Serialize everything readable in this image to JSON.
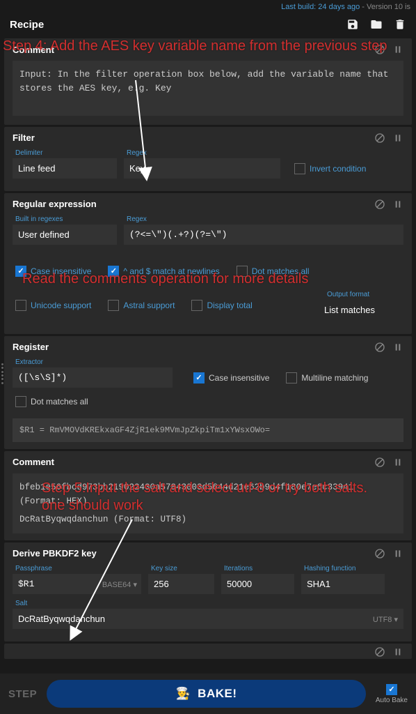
{
  "header": {
    "last_build": "Last build: 24 days ago",
    "version": " - Version 10 is"
  },
  "recipe": {
    "title": "Recipe"
  },
  "comment1": {
    "title": "Comment",
    "text": "Input: In the filter operation box below, add the variable name that stores the AES key, e.g. Key"
  },
  "filter": {
    "title": "Filter",
    "delimiter": {
      "label": "Delimiter",
      "value": "Line feed"
    },
    "regex": {
      "label": "Regex",
      "value": "Key"
    },
    "invert": "Invert condition"
  },
  "regex_op": {
    "title": "Regular expression",
    "builtin": {
      "label": "Built in regexes",
      "value": "User defined"
    },
    "regex": {
      "label": "Regex",
      "value": "(?<=\\\")(.+?)(?=\\\")"
    },
    "case_insensitive": "Case insensitive",
    "match_newlines": "^ and $ match at newlines",
    "dot_matches": "Dot matches all",
    "unicode": "Unicode support",
    "astral": "Astral support",
    "display_total": "Display total",
    "output_format": {
      "label": "Output format",
      "value": "List matches"
    }
  },
  "register": {
    "title": "Register",
    "extractor": {
      "label": "Extractor",
      "value": "([\\s\\S]*)"
    },
    "case_insensitive": "Case insensitive",
    "multiline": "Multiline matching",
    "dot_matches": "Dot matches all",
    "result": "$R1 = RmVMOVdKREkxaGF4ZjR1ek9MVmJpZkpiTm1xYWsxOWo="
  },
  "comment2": {
    "title": "Comment",
    "line1": "bfeb1e56fbcd973bb219022430a57843003d5644d21e62b9d4f180e7e6c33941",
    "line2": "(Format: HEX)",
    "line3": "DcRatByqwqdanchun (Format: UTF8)"
  },
  "pbkdf2": {
    "title": "Derive PBKDF2 key",
    "passphrase": {
      "label": "Passphrase",
      "value": "$R1",
      "enc": "BASE64"
    },
    "keysize": {
      "label": "Key size",
      "value": "256"
    },
    "iterations": {
      "label": "Iterations",
      "value": "50000"
    },
    "hashing": {
      "label": "Hashing function",
      "value": "SHA1"
    },
    "salt": {
      "label": "Salt",
      "value": "DcRatByqwqdanchun",
      "enc": "UTF8"
    }
  },
  "footer": {
    "step": "STEP",
    "bake": "BAKE!",
    "auto_bake": "Auto Bake"
  },
  "annotations": {
    "step4": "Step 4: Add the AES key variable name from the previous step",
    "step3": "Read the comments operation for more details",
    "step5": "Step 5:Input the salt and select utf-8 or try both salts. one should work"
  }
}
